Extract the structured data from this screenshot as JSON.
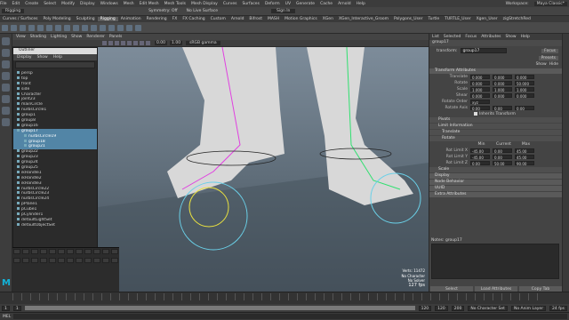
{
  "menubar": {
    "items": [
      "File",
      "Edit",
      "Create",
      "Select",
      "Modify",
      "Display",
      "Windows",
      "Mesh",
      "Edit Mesh",
      "Mesh Tools",
      "Mesh Display",
      "Curves",
      "Surfaces",
      "Deform",
      "UV",
      "Generate",
      "Cache",
      "Arnold",
      "Help"
    ],
    "workspace_label": "Workspace:",
    "workspace_value": "Maya Classic*"
  },
  "status": {
    "mode": "Rigging",
    "symmetry": "Symmetry: Off",
    "no_live": "No Live Surface",
    "sign_in": "Sign In"
  },
  "shelf_tabs": [
    "Curves / Surfaces",
    "Poly Modeling",
    "Sculpting",
    "Rigging",
    "Animation",
    "Rendering",
    "FX",
    "FX Caching",
    "Custom",
    "Arnold",
    "Bifrost",
    "MASH",
    "Motion Graphics",
    "XGen",
    "XGen_Interactive_Groom",
    "Polygons_User",
    "Turtle",
    "TURTLE_User",
    "Xgen_User",
    "zigStretchRed"
  ],
  "shelf_active": "Rigging",
  "viewport": {
    "menu": [
      "View",
      "Shading",
      "Lighting",
      "Show",
      "Renderer",
      "Panels"
    ],
    "gamma": "sRGB gamma",
    "field1": "0.00",
    "field2": "1.00",
    "hud": {
      "verts_label": "Verts:",
      "verts": "11472",
      "line2": "No Character",
      "line3": "No Solver",
      "fps": "127 fps"
    }
  },
  "outliner": {
    "title": "Outliner",
    "menu": [
      "Display",
      "Show",
      "Help"
    ],
    "rows": [
      {
        "label": "persp",
        "sel": false
      },
      {
        "label": "top",
        "sel": false
      },
      {
        "label": "front",
        "sel": false
      },
      {
        "label": "side",
        "sel": false
      },
      {
        "label": "Character",
        "sel": false
      },
      {
        "label": "joint23",
        "sel": false
      },
      {
        "label": "mainCircle",
        "sel": false
      },
      {
        "label": "nurbsCircle1",
        "sel": false
      },
      {
        "label": "group1",
        "sel": false
      },
      {
        "label": "group8",
        "sel": false
      },
      {
        "label": "group16",
        "sel": false
      },
      {
        "label": "group17",
        "sel": true
      },
      {
        "label": "nurbsCircle19",
        "sel": true
      },
      {
        "label": "group18",
        "sel": true
      },
      {
        "label": "group21",
        "sel": true
      },
      {
        "label": "group22",
        "sel": false
      },
      {
        "label": "group23",
        "sel": false
      },
      {
        "label": "group24",
        "sel": false
      },
      {
        "label": "group25",
        "sel": false
      },
      {
        "label": "ikHandle1",
        "sel": false
      },
      {
        "label": "ikHandle2",
        "sel": false
      },
      {
        "label": "ikHandle3",
        "sel": false
      },
      {
        "label": "nurbsCircle22",
        "sel": false
      },
      {
        "label": "nurbsCircle23",
        "sel": false
      },
      {
        "label": "nurbsCircle24",
        "sel": false
      },
      {
        "label": "pPlane1",
        "sel": false
      },
      {
        "label": "pCube1",
        "sel": false
      },
      {
        "label": "pCylinder1",
        "sel": false
      },
      {
        "label": "defaultLightSet",
        "sel": false
      },
      {
        "label": "defaultObjectSet",
        "sel": false
      }
    ]
  },
  "attr": {
    "menu": [
      "List",
      "Selected",
      "Focus",
      "Attributes",
      "Show",
      "Help"
    ],
    "tab": "group17",
    "transform_label": "transform:",
    "transform_value": "group17",
    "focus": "Focus",
    "presets": "Presets",
    "show": "Show",
    "hide": "Hide",
    "sections": {
      "transform_attrs": "Transform Attributes",
      "pivots": "Pivots",
      "limit": "Limit Information",
      "translate": "Translate",
      "rotate": "Rotate",
      "scale": "Scale",
      "display": "Display",
      "node_behavior": "Node Behavior",
      "uuid": "UUID",
      "extra": "Extra Attributes"
    },
    "transform_rows": [
      {
        "label": "Translate",
        "v": [
          "0.000",
          "0.000",
          "0.000"
        ]
      },
      {
        "label": "Rotate",
        "v": [
          "0.000",
          "0.000",
          "50.000"
        ]
      },
      {
        "label": "Scale",
        "v": [
          "1.000",
          "1.000",
          "1.000"
        ]
      },
      {
        "label": "Shear",
        "v": [
          "0.000",
          "0.000",
          "0.000"
        ]
      },
      {
        "label": "Rotate Order",
        "v": [
          "xyz",
          "",
          ""
        ]
      },
      {
        "label": "Rotate Axis",
        "v": [
          "0.00",
          "0.00",
          "0.00"
        ]
      }
    ],
    "inherits": "Inherits Transform",
    "rot_header": [
      "Min",
      "Current",
      "Max"
    ],
    "rot_rows": [
      {
        "label": "Rot Limit X",
        "v": [
          "-45.00",
          "0.00",
          "45.00"
        ]
      },
      {
        "label": "Rot Limit Y",
        "v": [
          "-45.00",
          "0.00",
          "45.00"
        ]
      },
      {
        "label": "Rot Limit Z",
        "v": [
          "0.00",
          "50.00",
          "90.00"
        ]
      }
    ],
    "notes_label": "Notes: group17",
    "buttons": [
      "Select",
      "Load Attributes",
      "Copy Tab"
    ]
  },
  "timeline": {
    "start": "1",
    "end": "24",
    "range_start": "1",
    "range_end": "120",
    "range_end2": "120",
    "range_max": "200",
    "character": "No Character Set",
    "anim_layer": "No Anim Layer",
    "fps": "24 fps"
  },
  "cmdline": {
    "label": "MEL"
  }
}
